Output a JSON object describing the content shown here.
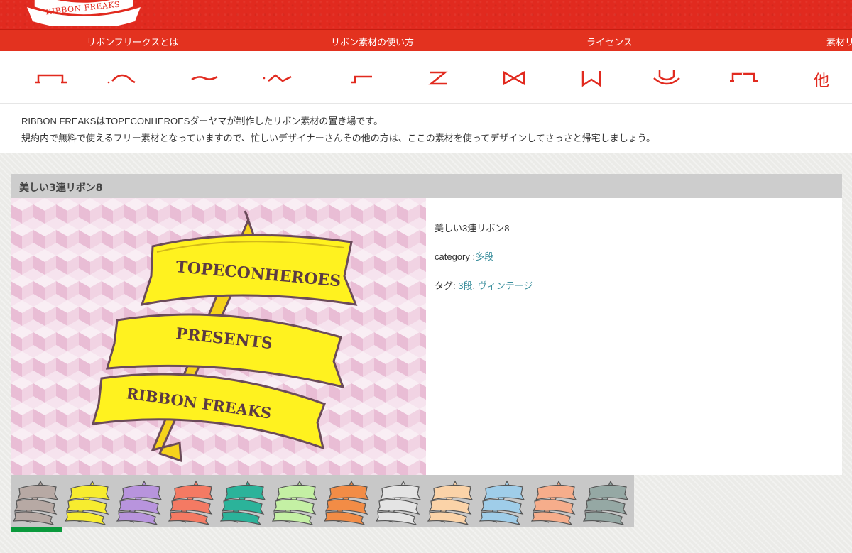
{
  "header": {
    "logo_text": "RIBBON FREAKS",
    "brand_color": "#e12a1f"
  },
  "nav": {
    "items": [
      {
        "label": "リボンフリークスとは"
      },
      {
        "label": "リボン素材の使い方"
      },
      {
        "label": "ライセンス"
      },
      {
        "label": "素材リ"
      }
    ]
  },
  "category_icons": [
    {
      "icon": "ribbon-flat-icon"
    },
    {
      "icon": "ribbon-arch-icon"
    },
    {
      "icon": "ribbon-wave-icon"
    },
    {
      "icon": "ribbon-s-wave-icon"
    },
    {
      "icon": "ribbon-step-icon"
    },
    {
      "icon": "ribbon-z-icon"
    },
    {
      "icon": "ribbon-bow-icon"
    },
    {
      "icon": "ribbon-banner-icon"
    },
    {
      "icon": "ribbon-emblem-icon"
    },
    {
      "icon": "ribbon-multi-icon"
    },
    {
      "icon": "other-icon",
      "label": "他"
    }
  ],
  "intro": {
    "line1": "RIBBON FREAKSはTOPECONHEROESダーヤマが制作したリボン素材の置き場です。",
    "line2": "規約内で無料で使えるフリー素材となっていますので、忙しいデザイナーさんその他の方は、ここの素材を使ってデザインしてさっさと帰宅しましょう。"
  },
  "card": {
    "title": "美しい3連リボン8",
    "preview": {
      "ribbon_texts": [
        "TOPECONHEROES",
        "PRESENTS",
        "RIBBON FREAKS"
      ],
      "ribbon_color": "#fff21f",
      "pattern_color": "#e8b6d0"
    },
    "info": {
      "name": "美しい3連リボン8",
      "category_label": "category :",
      "category_value": "多段",
      "tags_label": "タグ: ",
      "tag1": "3段",
      "tag_sep": ", ",
      "tag2": "ヴィンテージ"
    }
  },
  "thumbnails": [
    {
      "color": "#b7a9a4"
    },
    {
      "color": "#f7ec2f"
    },
    {
      "color": "#b894dd"
    },
    {
      "color": "#f47a63"
    },
    {
      "color": "#2bb39a"
    },
    {
      "color": "#c4f0a4"
    },
    {
      "color": "#f28c46"
    },
    {
      "color": "#e4e4e4"
    },
    {
      "color": "#fbd3a8"
    },
    {
      "color": "#9fcde9"
    },
    {
      "color": "#f6ad8b"
    },
    {
      "color": "#95a8a4"
    }
  ],
  "progress": {
    "fraction": 0.083,
    "color": "#0a9a3c"
  }
}
